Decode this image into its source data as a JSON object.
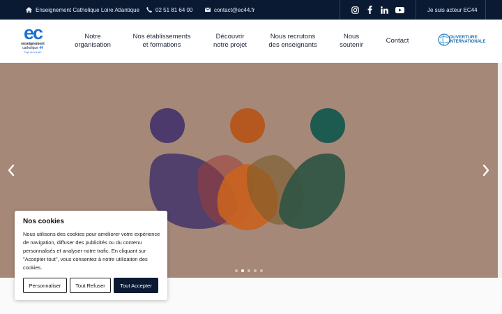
{
  "topbar": {
    "org_name": "Enseignement Catholique Loire Atlantique",
    "phone": "02 51 81 64 00",
    "email": "contact@ec44.fr",
    "social_icons": [
      "instagram-icon",
      "facebook-icon",
      "linkedin-icon",
      "youtube-icon"
    ],
    "actor_link": "Je suis acteur EC44"
  },
  "logo": {
    "mark": "ec",
    "line1": "enseignement",
    "line2": "catholique",
    "number": "44",
    "region": "Pays de la Loire"
  },
  "nav": {
    "items": [
      {
        "label": "Notre\norganisation"
      },
      {
        "label": "Nos établissements\net formations"
      },
      {
        "label": "Découvrir\nnotre projet"
      },
      {
        "label": "Nous recrutons\ndes enseignants"
      },
      {
        "label": "Nous\nsoutenir"
      },
      {
        "label": "Contact"
      }
    ]
  },
  "partner_logo": {
    "line1": "OUVERTURE",
    "line2": "INTERNATIONALE"
  },
  "hero": {
    "slide_count": 5,
    "active_slide": 2,
    "colors": {
      "background": "#a68878",
      "figure_left": "#4b3a6b",
      "figure_mid": "#b5581f",
      "figure_right": "#1d5b50"
    }
  },
  "cookie": {
    "title": "Nos cookies",
    "text": "Nous utilisons des cookies pour améliorer votre expérience de navigation, diffuser des publicités ou du contenu personnalisés et analyser notre trafic. En cliquant sur \"Accepter tout\", vous consentez à notre utilisation des cookies.",
    "customize": "Personnaliser",
    "refuse": "Tout Refuser",
    "accept": "Tout Accepter"
  },
  "colors": {
    "topbar": "#0b1a33",
    "brand_blue": "#1f6fd1",
    "accept_button": "#0b1a33"
  }
}
